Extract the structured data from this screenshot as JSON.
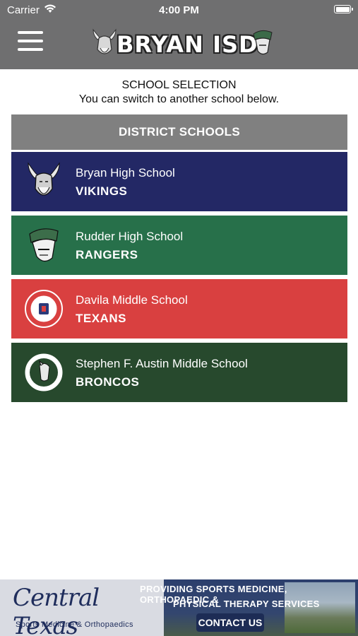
{
  "status_bar": {
    "carrier": "Carrier",
    "time": "4:00 PM"
  },
  "header": {
    "brand": "BRYAN ISD"
  },
  "selection": {
    "title": "SCHOOL SELECTION",
    "subtitle": "You can switch to another school below."
  },
  "district": {
    "label": "DISTRICT SCHOOLS"
  },
  "schools": [
    {
      "name": "Bryan High School",
      "mascot": "VIKINGS",
      "color": "#232865"
    },
    {
      "name": "Rudder High School",
      "mascot": "RANGERS",
      "color": "#27704a"
    },
    {
      "name": "Davila Middle School",
      "mascot": "TEXANS",
      "color": "#d94040"
    },
    {
      "name": "Stephen F. Austin Middle School",
      "mascot": "BRONCOS",
      "color": "#27492d"
    }
  ],
  "ad": {
    "brand": "Central Texas",
    "brand_sub": "Sports Medicine & Orthopaedics",
    "line1": "PROVIDING SPORTS MEDICINE, ORTHOPAEDIC &",
    "line2": "PHYSICAL THERAPY SERVICES",
    "cta": "CONTACT US"
  },
  "colors": {
    "header_bg": "#6f6f70",
    "district_bar": "#808080"
  }
}
